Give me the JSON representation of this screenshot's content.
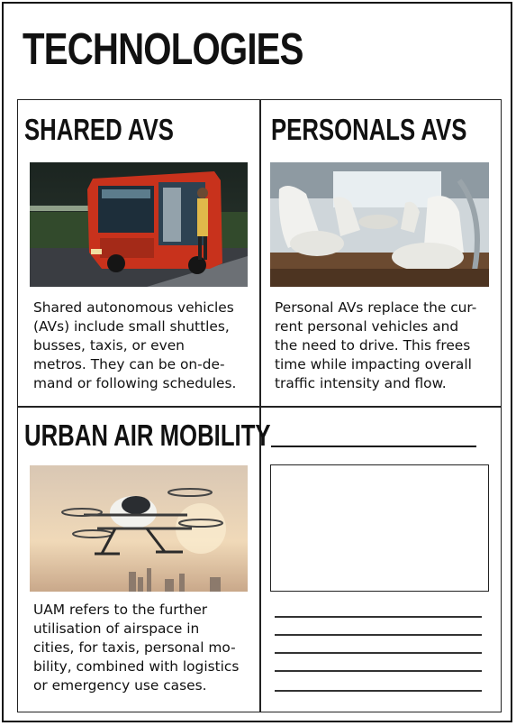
{
  "page": {
    "title": "TECHNOLOGIES"
  },
  "cells": {
    "shared": {
      "title": "SHARED AVS",
      "image_icon": "autonomous-shuttle-photo",
      "text_lines": [
        "Shared autonomous vehicles",
        "(AVs) include small shuttles,",
        "busses, taxis, or even",
        "metros. They can be on-de-",
        "mand or following schedules."
      ]
    },
    "personal": {
      "title": "PERSONALS AVS",
      "image_icon": "car-interior-photo",
      "text_lines": [
        "Personal AVs replace the cur-",
        "rent personal vehicles and",
        "the need to drive. This frees",
        "time while impacting overall",
        "traffic intensity and flow."
      ]
    },
    "uam": {
      "title": "URBAN AIR MOBILITY",
      "image_icon": "passenger-drone-photo",
      "text_lines": [
        "UAM refers to the further",
        "utilisation of airspace in",
        "cities, for taxis, personal mo-",
        "bility, combined with logistics",
        "or emergency use cases."
      ]
    },
    "blank": {
      "write_lines": 5
    }
  },
  "colors": {
    "ink": "#111111",
    "shuttle_red": "#c8321c",
    "sky_warm": "#e9c9a4"
  }
}
